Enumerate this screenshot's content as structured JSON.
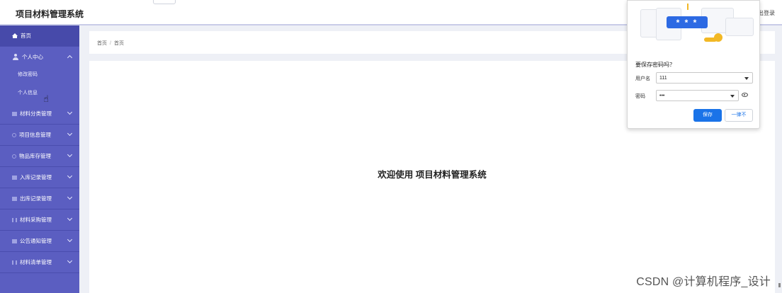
{
  "header": {
    "title": "项目材料管理系统",
    "logout_label": "出登录"
  },
  "sidebar": {
    "items": [
      {
        "label": "首页",
        "icon": "home-icon"
      },
      {
        "label": "个人中心",
        "icon": "person-icon",
        "expanded": true
      },
      {
        "label": "材料分类管理",
        "icon": "category-icon"
      },
      {
        "label": "项目信息管理",
        "icon": "project-icon"
      },
      {
        "label": "物品库存管理",
        "icon": "inventory-icon"
      },
      {
        "label": "入库记录管理",
        "icon": "inbound-icon"
      },
      {
        "label": "出库记录管理",
        "icon": "outbound-icon"
      },
      {
        "label": "材料采购管理",
        "icon": "purchase-icon"
      },
      {
        "label": "公告通知管理",
        "icon": "notice-icon"
      },
      {
        "label": "材料清单管理",
        "icon": "list-icon"
      }
    ],
    "subitems": [
      {
        "label": "修改密码"
      },
      {
        "label": "个人信息"
      }
    ]
  },
  "breadcrumb": {
    "items": [
      "首页",
      "首页"
    ],
    "separator": "/"
  },
  "main": {
    "welcome_text": "欢迎使用 项目材料管理系统"
  },
  "password_popup": {
    "title": "要保存密码吗？",
    "username_label": "用户名",
    "username_value": "111",
    "password_label": "密码",
    "password_value": "•••",
    "illustration_text": "* * *",
    "save_label": "保存",
    "never_label": "一律不"
  },
  "watermark": "CSDN @计算机程序_设计",
  "colors": {
    "sidebar_bg": "#5b5ec1",
    "accent_blue": "#1a73e8",
    "key_yellow": "#f2b825"
  }
}
